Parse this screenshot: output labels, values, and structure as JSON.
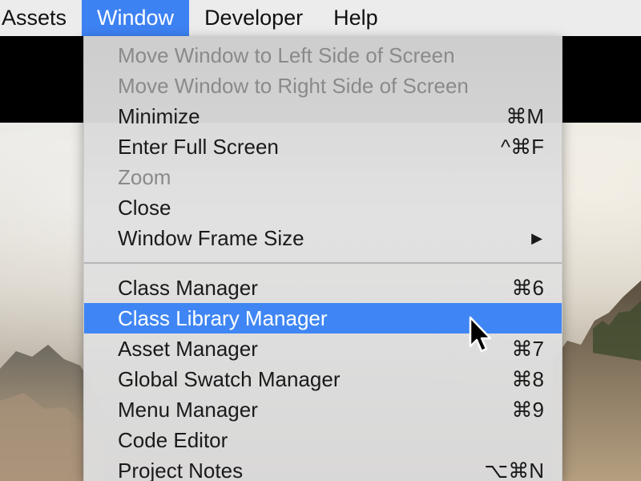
{
  "menubar": {
    "items": [
      {
        "label": "Assets"
      },
      {
        "label": "Window"
      },
      {
        "label": "Developer"
      },
      {
        "label": "Help"
      }
    ]
  },
  "window_menu": {
    "group1": [
      {
        "label": "Move Window to Left Side of Screen",
        "shortcut": "",
        "enabled": false
      },
      {
        "label": "Move Window to Right Side of Screen",
        "shortcut": "",
        "enabled": false
      },
      {
        "label": "Minimize",
        "shortcut": "⌘M",
        "enabled": true
      },
      {
        "label": "Enter Full Screen",
        "shortcut": "^⌘F",
        "enabled": true
      },
      {
        "label": "Zoom",
        "shortcut": "",
        "enabled": false
      },
      {
        "label": "Close",
        "shortcut": "",
        "enabled": true
      },
      {
        "label": "Window Frame Size",
        "shortcut": "▶",
        "enabled": true
      }
    ],
    "group2": [
      {
        "label": "Class Manager",
        "shortcut": "⌘6",
        "enabled": true
      },
      {
        "label": "Class Library Manager",
        "shortcut": "",
        "enabled": true
      },
      {
        "label": "Asset Manager",
        "shortcut": "⌘7",
        "enabled": true
      },
      {
        "label": "Global Swatch Manager",
        "shortcut": "⌘8",
        "enabled": true
      },
      {
        "label": "Menu Manager",
        "shortcut": "⌘9",
        "enabled": true
      },
      {
        "label": "Code Editor",
        "shortcut": "",
        "enabled": true
      },
      {
        "label": "Project Notes",
        "shortcut": "⌥⌘N",
        "enabled": true
      }
    ]
  },
  "colors": {
    "highlight": "#3f86f4",
    "menubar_bg": "#ececec",
    "disabled_text": "#8a8a8a"
  },
  "icons": {
    "submenu": "submenu-arrow-icon",
    "cursor": "mouse-pointer-icon"
  }
}
